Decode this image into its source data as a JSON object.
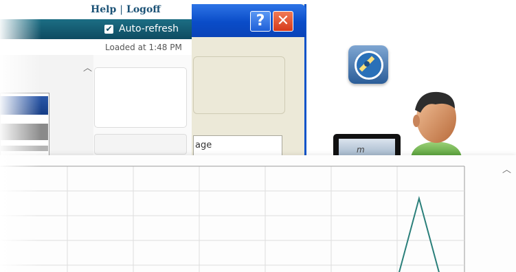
{
  "header": {
    "help_label": "Help",
    "separator": "|",
    "logoff_label": "Logoff",
    "auto_refresh_label": "Auto-refresh",
    "auto_refresh_checked": true,
    "loaded_at": "Loaded at 1:48 PM",
    "bar_color": "#0e4b61",
    "link_color": "#1b5276"
  },
  "dialog": {
    "help_button_glyph": "?",
    "close_button_glyph": "✕",
    "field_text": "age",
    "titlebar_color": "#0a4cc8"
  },
  "desktop_icons": [
    {
      "name": "compass-icon"
    },
    {
      "name": "tablet-device-icon",
      "label": "m"
    },
    {
      "name": "user-avatar-icon"
    }
  ],
  "chart_data": {
    "type": "line",
    "series_color": "#2a7f7a",
    "grid": true,
    "x": [
      0,
      1,
      2,
      3,
      4,
      5,
      6,
      7,
      8,
      9,
      10,
      11,
      12,
      13,
      14,
      15,
      16,
      17,
      18,
      19,
      20,
      21
    ],
    "values": [
      0,
      0,
      0,
      0,
      0,
      0,
      0,
      0,
      0,
      0,
      0,
      0,
      0,
      0,
      0,
      0,
      0,
      0,
      0,
      1,
      0,
      0
    ],
    "xlim": [
      0,
      21
    ],
    "ylim": [
      0,
      1.2
    ]
  }
}
